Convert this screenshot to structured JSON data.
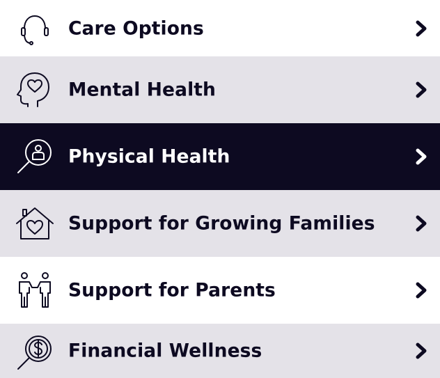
{
  "menu": {
    "items": [
      {
        "label": "Care Options",
        "icon": "headset-icon",
        "state": "default"
      },
      {
        "label": "Mental Health",
        "icon": "head-heart-icon",
        "state": "default"
      },
      {
        "label": "Physical Health",
        "icon": "magnifier-person-icon",
        "state": "selected"
      },
      {
        "label": "Support for Growing Families",
        "icon": "house-heart-icon",
        "state": "default"
      },
      {
        "label": "Support for Parents",
        "icon": "parent-child-icon",
        "state": "default"
      },
      {
        "label": "Financial Wellness",
        "icon": "magnifier-dollar-icon",
        "state": "default"
      }
    ]
  },
  "colors": {
    "dark": "#0d0a21",
    "grey": "#e4e2e8",
    "white": "#ffffff"
  }
}
